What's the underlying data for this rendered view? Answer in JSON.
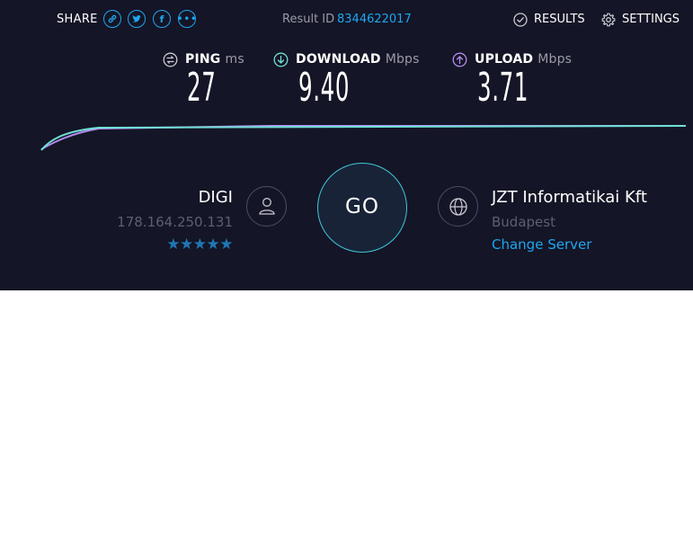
{
  "header": {
    "share_label": "SHARE",
    "share_icons": [
      "link-icon",
      "twitter-icon",
      "facebook-icon",
      "more-icon"
    ],
    "result_id_label": "Result ID",
    "result_id_value": "8344622017",
    "results_label": "RESULTS",
    "settings_label": "SETTINGS"
  },
  "metrics": {
    "ping": {
      "label": "PING",
      "unit": "ms",
      "value": "27"
    },
    "download": {
      "label": "DOWNLOAD",
      "unit": "Mbps",
      "value": "9.40"
    },
    "upload": {
      "label": "UPLOAD",
      "unit": "Mbps",
      "value": "3.71"
    }
  },
  "isp": {
    "name": "DIGI",
    "ip": "178.164.250.131",
    "rating_stars": 5,
    "stars_text": "★★★★★"
  },
  "go_button": {
    "label": "GO"
  },
  "server": {
    "name": "JZT Informatikai Kft",
    "city": "Budapest",
    "change_label": "Change Server"
  },
  "colors": {
    "panel_bg": "#141526",
    "accent_blue": "#1fa6f0",
    "download_teal": "#6fe0d6",
    "upload_purple": "#b58cf0",
    "go_ring": "#3fc7d6",
    "star_blue": "#1f77b4"
  }
}
